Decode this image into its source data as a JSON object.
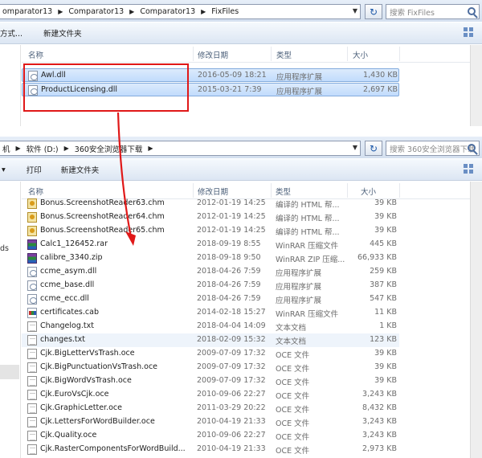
{
  "window1": {
    "breadcrumb": [
      "omparator13",
      "Comparator13",
      "Comparator13",
      "FixFiles"
    ],
    "search_placeholder": "搜索 FixFiles",
    "toolbar": [
      "方式...",
      "新建文件夹"
    ],
    "columns": {
      "name": "名称",
      "date": "修改日期",
      "type": "类型",
      "size": "大小"
    },
    "files": [
      {
        "name": "Awl.dll",
        "date": "2016-05-09 18:21",
        "type": "应用程序扩展",
        "size": "1,430 KB",
        "icon": "dll-icon",
        "selected": true
      },
      {
        "name": "ProductLicensing.dll",
        "date": "2015-03-21 7:39",
        "type": "应用程序扩展",
        "size": "2,697 KB",
        "icon": "dll-icon",
        "selected": true
      }
    ]
  },
  "window2": {
    "breadcrumb": [
      "机",
      "软件 (D:)",
      "360安全浏览器下载"
    ],
    "search_placeholder": "搜索 360安全浏览器下载",
    "toolbar": [
      "打印",
      "新建文件夹"
    ],
    "left_fragment": "ds",
    "columns": {
      "name": "名称",
      "date": "修改日期",
      "type": "类型",
      "size": "大小"
    },
    "files": [
      {
        "name": "Bonus.ScreenshotReader63.chm",
        "date": "2012-01-19 14:25",
        "type": "编译的 HTML 帮...",
        "size": "39 KB",
        "icon": "chm-icon"
      },
      {
        "name": "Bonus.ScreenshotReader64.chm",
        "date": "2012-01-19 14:25",
        "type": "编译的 HTML 帮...",
        "size": "39 KB",
        "icon": "chm-icon"
      },
      {
        "name": "Bonus.ScreenshotReader65.chm",
        "date": "2012-01-19 14:25",
        "type": "编译的 HTML 帮...",
        "size": "39 KB",
        "icon": "chm-icon"
      },
      {
        "name": "Calc1_126452.rar",
        "date": "2018-09-19 8:55",
        "type": "WinRAR 压缩文件",
        "size": "445 KB",
        "icon": "rar-icon"
      },
      {
        "name": "calibre_3340.zip",
        "date": "2018-09-18 9:50",
        "type": "WinRAR ZIP 压缩...",
        "size": "66,933 KB",
        "icon": "rar-icon"
      },
      {
        "name": "ccme_asym.dll",
        "date": "2018-04-26 7:59",
        "type": "应用程序扩展",
        "size": "259 KB",
        "icon": "dll-icon"
      },
      {
        "name": "ccme_base.dll",
        "date": "2018-04-26 7:59",
        "type": "应用程序扩展",
        "size": "387 KB",
        "icon": "dll-icon"
      },
      {
        "name": "ccme_ecc.dll",
        "date": "2018-04-26 7:59",
        "type": "应用程序扩展",
        "size": "547 KB",
        "icon": "dll-icon"
      },
      {
        "name": "certificates.cab",
        "date": "2014-02-18 15:27",
        "type": "WinRAR 压缩文件",
        "size": "11 KB",
        "icon": "cab-icon"
      },
      {
        "name": "Changelog.txt",
        "date": "2018-04-04 14:09",
        "type": "文本文档",
        "size": "1 KB",
        "icon": "txt-icon"
      },
      {
        "name": "changes.txt",
        "date": "2018-02-09 15:32",
        "type": "文本文档",
        "size": "123 KB",
        "icon": "txt-icon",
        "hover": true
      },
      {
        "name": "Cjk.BigLetterVsTrash.oce",
        "date": "2009-07-09 17:32",
        "type": "OCE 文件",
        "size": "39 KB",
        "icon": "txt-icon"
      },
      {
        "name": "Cjk.BigPunctuationVsTrash.oce",
        "date": "2009-07-09 17:32",
        "type": "OCE 文件",
        "size": "39 KB",
        "icon": "txt-icon"
      },
      {
        "name": "Cjk.BigWordVsTrash.oce",
        "date": "2009-07-09 17:32",
        "type": "OCE 文件",
        "size": "39 KB",
        "icon": "txt-icon"
      },
      {
        "name": "Cjk.EuroVsCjk.oce",
        "date": "2010-09-06 22:27",
        "type": "OCE 文件",
        "size": "3,243 KB",
        "icon": "txt-icon"
      },
      {
        "name": "Cjk.GraphicLetter.oce",
        "date": "2011-03-29 20:22",
        "type": "OCE 文件",
        "size": "8,432 KB",
        "icon": "txt-icon"
      },
      {
        "name": "Cjk.LettersForWordBuilder.oce",
        "date": "2010-04-19 21:33",
        "type": "OCE 文件",
        "size": "3,243 KB",
        "icon": "txt-icon"
      },
      {
        "name": "Cjk.Quality.oce",
        "date": "2010-09-06 22:27",
        "type": "OCE 文件",
        "size": "3,243 KB",
        "icon": "txt-icon"
      },
      {
        "name": "Cjk.RasterComponentsForWordBuild...",
        "date": "2010-04-19 21:33",
        "type": "OCE 文件",
        "size": "2,973 KB",
        "icon": "txt-icon"
      }
    ]
  },
  "colors": {
    "selection": "#c7defc",
    "annotation": "#e01818",
    "header_text": "#4c607a"
  }
}
